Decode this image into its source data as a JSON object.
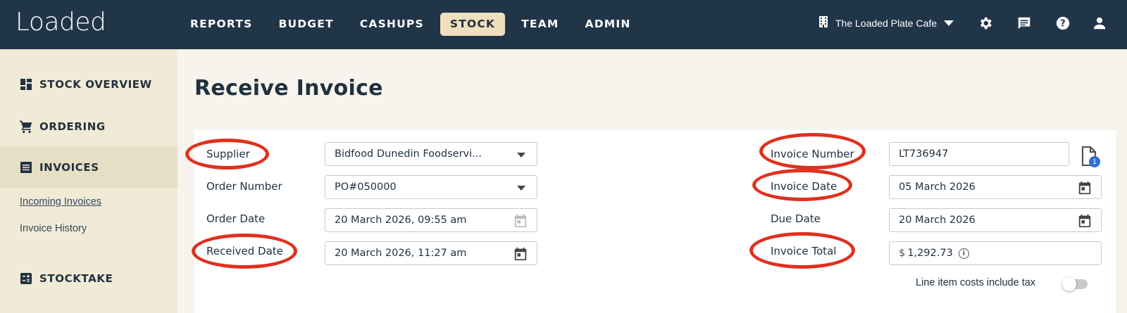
{
  "app": {
    "logo": "Loaded"
  },
  "nav": [
    {
      "label": "REPORTS",
      "active": false
    },
    {
      "label": "BUDGET",
      "active": false
    },
    {
      "label": "CASHUPS",
      "active": false
    },
    {
      "label": "STOCK",
      "active": true
    },
    {
      "label": "TEAM",
      "active": false
    },
    {
      "label": "ADMIN",
      "active": false
    }
  ],
  "venue": {
    "name": "The Loaded Plate Cafe",
    "icon": "building-icon"
  },
  "top_icons": [
    "gear-icon",
    "chat-icon",
    "help-icon",
    "user-icon"
  ],
  "sidebar": {
    "items": [
      {
        "label": "STOCK OVERVIEW",
        "icon": "dashboard-icon"
      },
      {
        "label": "ORDERING",
        "icon": "cart-icon"
      },
      {
        "label": "INVOICES",
        "icon": "list-icon",
        "active": true
      },
      {
        "label": "STOCKTAKE",
        "icon": "calculator-icon"
      }
    ],
    "sub_links": [
      {
        "label": "Incoming Invoices",
        "current": true
      },
      {
        "label": "Invoice History",
        "current": false
      }
    ]
  },
  "page": {
    "title": "Receive Invoice"
  },
  "form": {
    "supplier": {
      "label": "Supplier",
      "value": "Bidfood Dunedin Foodservi..."
    },
    "order_number": {
      "label": "Order Number",
      "value": "PO#050000"
    },
    "order_date": {
      "label": "Order Date",
      "value": "20 March 2026, 09:55 am"
    },
    "received_date": {
      "label": "Received Date",
      "value": "20 March 2026, 11:27 am"
    },
    "invoice_number": {
      "label": "Invoice Number",
      "value": "LT736947"
    },
    "invoice_date": {
      "label": "Invoice Date",
      "value": "05 March 2026"
    },
    "due_date": {
      "label": "Due Date",
      "value": "20 March 2026"
    },
    "invoice_total": {
      "label": "Invoice Total",
      "currency": "$",
      "value": "1,292.73"
    },
    "attachment_count": "1",
    "tax_toggle": {
      "label": "Line item costs include tax",
      "on": false
    }
  },
  "colors": {
    "topbar": "#213549",
    "accent_tab": "#efdfbe",
    "highlight": "#e0301e",
    "badge": "#2f6fd0"
  }
}
